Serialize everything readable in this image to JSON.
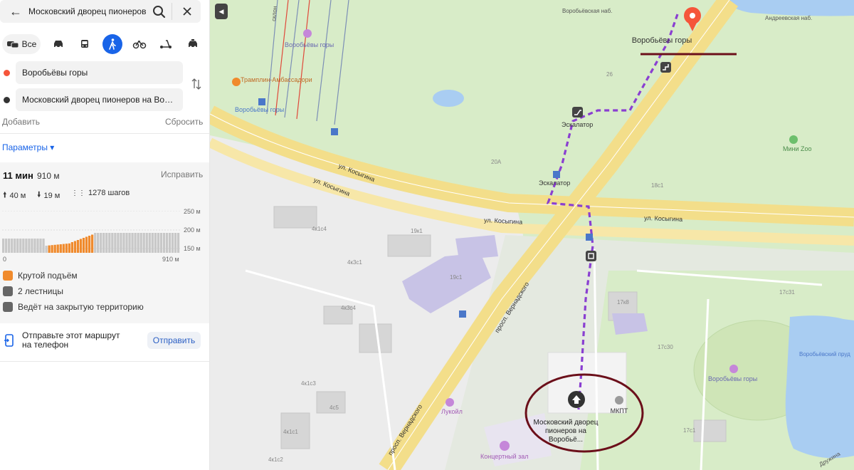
{
  "search": {
    "query": "Московский дворец пионеров и"
  },
  "modes": {
    "all_label": "Все",
    "active": "pedestrian"
  },
  "route": {
    "from": "Воробьёвы горы",
    "to": "Московский дворец пионеров на Воро...",
    "add_label": "Добавить",
    "reset_label": "Сбросить",
    "params_label": "Параметры ▾"
  },
  "summary": {
    "time": "11 мин",
    "distance": "910 м",
    "fix_label": "Исправить",
    "ascent": "40 м",
    "descent": "19 м",
    "steps": "1278 шагов",
    "chart_axis_left": "0",
    "chart_axis_right": "910 м",
    "chart_y1": "250 м",
    "chart_y2": "200 м",
    "chart_y3": "150 м"
  },
  "warnings": {
    "steep": "Крутой подъём",
    "stairs": "2 лестницы",
    "closed": "Ведёт на закрытую территорию"
  },
  "send": {
    "text": "Отправьте этот маршрут на телефон",
    "button": "Отправить"
  },
  "colors": {
    "route": "#8a3fd1",
    "accent": "#1964e8",
    "pin": "#f5553a",
    "annotation": "#6b0f1a",
    "steep": "#f08a2c"
  },
  "map_labels": {
    "pin_label": "Воробьёвы горы",
    "vorobyevskaya_nab": "Воробьёвская наб.",
    "andreevskaya_nab": "Андреевская наб.",
    "vorobyovy_gory_metro_top": "Воробьёвы горы",
    "vorobyovy_gory_station": "Воробьёвы горы",
    "tramplin": "Трамплин-Амбассадори",
    "escalator1": "Эскалатор",
    "escalator2": "Эскалатор",
    "mini_zoo": "Мини Zoo",
    "kosygina1": "ул. Косыгина",
    "kosygina2": "ул. Косыгина",
    "kosygina3": "ул. Косыгина",
    "kosygina4": "ул. Косыгина",
    "vernadskogo1": "просп. Вернадского",
    "vernadskogo2": "просп. Вернадского",
    "destination": "Московский дворец пионеров на Воробьё...",
    "mkpt": "МКПТ",
    "concert": "Концертный зал",
    "lukoil": "Лукойл",
    "vorobyovy_gory_park": "Воробьёвы горы",
    "pond": "Воробьёвский пруд",
    "h26": "26",
    "h20a": "20А",
    "h18c1": "18с1",
    "h19k1": "19к1",
    "h19c1": "19с1",
    "h4k1c4": "4к1с4",
    "h4k3c1": "4к3с1",
    "h4k3c4": "4к3с4",
    "h17k8": "17к8",
    "h17c30": "17с30",
    "h17c31": "17с31",
    "h17c1": "17с1",
    "h4k1c3": "4к1с3",
    "h4c5": "4с5",
    "h4k1c1": "4к1с1",
    "h4k1c2": "4к1с2",
    "skolov": "склон",
    "akruzhina": "Дружина"
  }
}
